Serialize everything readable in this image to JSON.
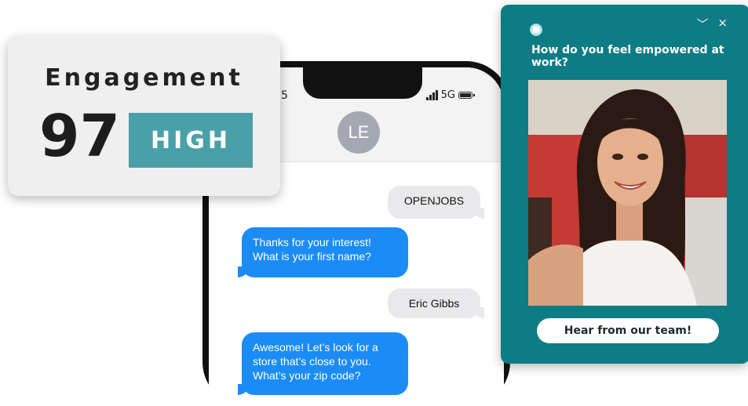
{
  "engagement": {
    "title": "Engagement",
    "score": "97",
    "level": "HIGH",
    "level_color": "#4aa0a8"
  },
  "phone": {
    "status_time": "5",
    "network": "5G",
    "contact_initials": "LE",
    "messages": [
      {
        "direction": "incoming",
        "text": "OPENJOBS"
      },
      {
        "direction": "outgoing",
        "text": "Thanks for your interest! What is your first name?"
      },
      {
        "direction": "incoming",
        "text": "Eric Gibbs"
      },
      {
        "direction": "outgoing",
        "text": "Awesome! Let’s look for a store that’s close to you. What’s your zip code?"
      }
    ],
    "outgoing_color": "#1b8cf6",
    "incoming_color": "#e9e9eb"
  },
  "survey_widget": {
    "question": "How do you feel empowered at work?",
    "cta_label": "Hear from our team!",
    "controls": {
      "collapse_icon": "chevron-down-icon",
      "close_icon": "close-icon",
      "collapse_glyph": "﹀",
      "close_glyph": "×"
    },
    "background_color": "#0d7c84"
  }
}
